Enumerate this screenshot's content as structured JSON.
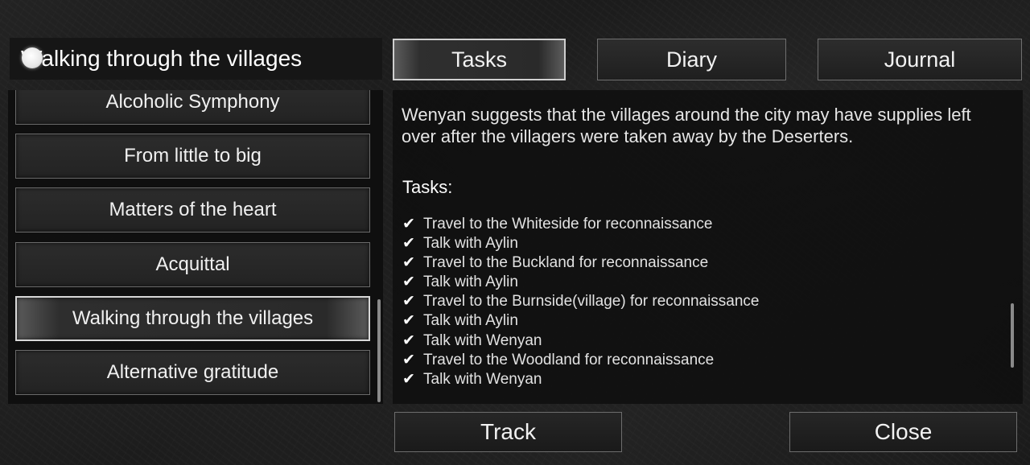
{
  "quest_header": {
    "title": "Walking through the villages"
  },
  "quests": [
    {
      "label": "Alcoholic Symphony",
      "active": false
    },
    {
      "label": "From little to big",
      "active": false
    },
    {
      "label": "Matters of the heart",
      "active": false
    },
    {
      "label": "Acquittal",
      "active": false
    },
    {
      "label": "Walking through the villages",
      "active": true
    },
    {
      "label": "Alternative gratitude",
      "active": false
    }
  ],
  "tabs": [
    {
      "label": "Tasks",
      "active": true
    },
    {
      "label": "Diary",
      "active": false
    },
    {
      "label": "Journal",
      "active": false
    }
  ],
  "content": {
    "description": "Wenyan suggests that the villages around the city may have supplies left over after the villagers were taken away by the Deserters.",
    "tasks_heading": "Tasks:",
    "task_check_glyph": "✔",
    "tasks": [
      "Travel to the Whiteside for reconnaissance",
      "Talk with Aylin",
      "Travel to the Buckland for reconnaissance",
      "Talk with Aylin",
      "Travel to the Burnside(village) for reconnaissance",
      "Talk with Aylin",
      "Talk with Wenyan",
      "Travel to the Woodland for reconnaissance",
      "Talk with Wenyan"
    ]
  },
  "buttons": {
    "track": "Track",
    "close": "Close"
  },
  "icons": {
    "header_marker": "quest-marker-icon",
    "task_check": "check-icon"
  },
  "colors": {
    "text": "#f2f2f2",
    "panel": "#161616",
    "border": "#6f6f6f",
    "active_border": "#d8d8d8"
  }
}
